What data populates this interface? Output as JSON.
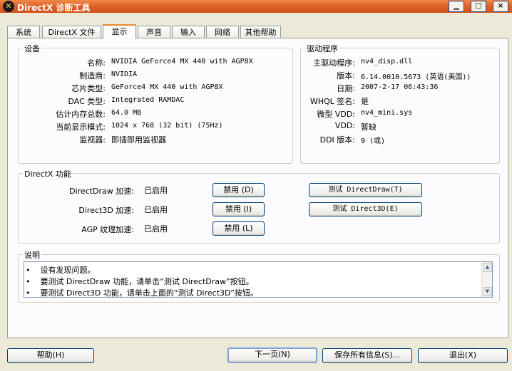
{
  "window": {
    "title": "DirectX 诊断工具"
  },
  "tabs": [
    "系统",
    "DirectX 文件",
    "显示",
    "声音",
    "输入",
    "网络",
    "其他帮助"
  ],
  "device": {
    "title": "设备",
    "rows": [
      {
        "label": "名称:",
        "value": "NVIDIA GeForce4 MX 440 with AGP8X"
      },
      {
        "label": "制造商:",
        "value": "NVIDIA"
      },
      {
        "label": "芯片类型:",
        "value": "GeForce4 MX 440 with AGP8X"
      },
      {
        "label": "DAC 类型:",
        "value": "Integrated RAMDAC"
      },
      {
        "label": "估计内存总数:",
        "value": "64.0 MB"
      },
      {
        "label": "当前显示模式:",
        "value": "1024 x 768 (32 bit) (75Hz)"
      },
      {
        "label": "监视器:",
        "value": "即插即用监视器"
      }
    ]
  },
  "driver": {
    "title": "驱动程序",
    "rows": [
      {
        "label": "主驱动程序:",
        "value": "nv4_disp.dll"
      },
      {
        "label": "版本:",
        "value": "6.14.0010.5673 (英语(美国))"
      },
      {
        "label": "日期:",
        "value": "2007-2-17 06:43:36"
      },
      {
        "label": "WHQL 签名:",
        "value": "是"
      },
      {
        "label": "微型 VDD:",
        "value": "nv4_mini.sys"
      },
      {
        "label": "VDD:",
        "value": "暂缺"
      },
      {
        "label": "DDI 版本:",
        "value": "9 (或)"
      }
    ]
  },
  "features": {
    "title": "DirectX 功能",
    "rows": [
      {
        "label": "DirectDraw 加速:",
        "status": "已启用",
        "disable": "禁用 (D)",
        "test": "测试 DirectDraw(T)"
      },
      {
        "label": "Direct3D 加速:",
        "status": "已启用",
        "disable": "禁用 (I)",
        "test": "测试 Direct3D(E)"
      },
      {
        "label": "AGP 纹理加速:",
        "status": "已启用",
        "disable": "禁用 (L)"
      }
    ]
  },
  "notes": {
    "title": "说明",
    "lines": [
      "设有发现问题。",
      "要测试 DirectDraw 功能，请单击“测试 DirectDraw”按钮。",
      "要测试 Direct3D 功能，请单击上面的“测试 Direct3D”按钮。"
    ]
  },
  "footer": {
    "help": "帮助(H)",
    "next": "下一页(N)",
    "save": "保存所有信息(S)...",
    "exit": "退出(X)"
  }
}
